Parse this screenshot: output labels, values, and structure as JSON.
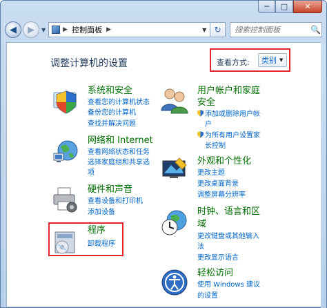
{
  "window": {
    "minimize_glyph": "─",
    "maximize_glyph": "□",
    "close_glyph": "✕"
  },
  "navbar": {
    "back_glyph": "◀",
    "forward_glyph": "▶",
    "history_glyph": "▼",
    "address": {
      "icon": "control-panel-icon",
      "separator_1": "▶",
      "crumb": "控制面板",
      "separator_2": "▶",
      "dropdown_glyph": "▼"
    },
    "refresh_glyph": "↻",
    "search_placeholder": "搜索控制面板",
    "search_glyph": "🔍"
  },
  "main": {
    "title": "调整计算机的设置",
    "view_by_label": "查看方式:",
    "view_by_value": "类别",
    "view_by_arrow": "▼"
  },
  "categories": {
    "system": {
      "title": "系统和安全",
      "links": [
        "查看您的计算机状态",
        "备份您的计算机",
        "查找并解决问题"
      ]
    },
    "network": {
      "title": "网络和 Internet",
      "links": [
        "查看网络状态和任务",
        "选择家庭组和共享选",
        "项"
      ]
    },
    "hardware": {
      "title": "硬件和声音",
      "links": [
        "查看设备和打印机",
        "添加设备"
      ]
    },
    "programs": {
      "title": "程序",
      "links": [
        "卸载程序"
      ]
    },
    "users": {
      "title_line1": "用户帐户和家庭",
      "title_line2": "安全",
      "links": [
        "添加或删除用户帐",
        "户",
        "为所有用户设置家",
        "长控制"
      ]
    },
    "appearance": {
      "title": "外观和个性化",
      "links": [
        "更改主题",
        "更改桌面背景",
        "调整屏幕分辨率"
      ]
    },
    "clock": {
      "title_line1": "时钟、语言和区",
      "title_line2": "域",
      "links": [
        "更改键盘或其他输入",
        "法",
        "更改显示语言"
      ]
    },
    "ease": {
      "title": "轻松访问",
      "links": [
        "使用 Windows 建议",
        "的设置"
      ]
    }
  },
  "colors": {
    "category_title": "#006f00",
    "link": "#0066cc",
    "highlight_box": "#e0262c",
    "page_title": "#1e395b"
  }
}
